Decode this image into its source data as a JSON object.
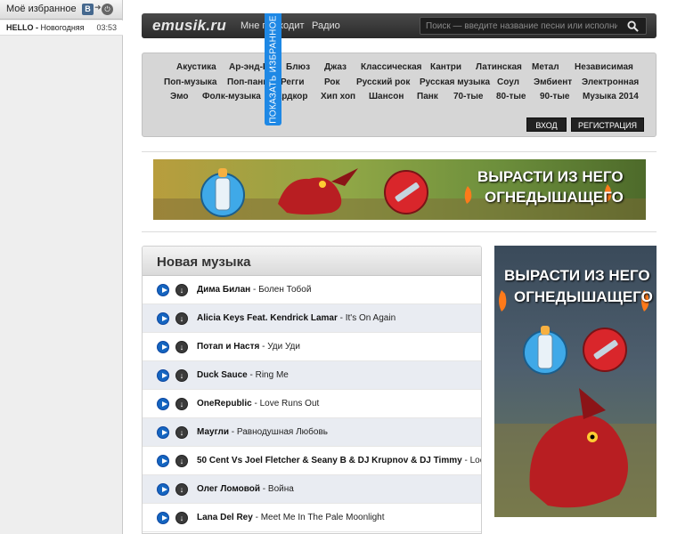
{
  "sidebar": {
    "title": "Моё избранное",
    "vk_label": "В",
    "track": {
      "name": "HELLO - ",
      "title": "Новогодняя",
      "duration": "03:53"
    }
  },
  "favorites_tab": "ПОКАЗАТЬ ИЗБРАННОЕ",
  "header": {
    "logo": "emusik.ru",
    "nav": [
      "Мне подходит",
      "Радио"
    ],
    "search_placeholder": "Поиск — введите название песни или исполнителя"
  },
  "genres": [
    [
      "Акустика",
      "Ар-энд-Би",
      "Блюз",
      "Джаз",
      "Классическая",
      "Кантри",
      "Латинская",
      "Метал",
      "Независимая"
    ],
    [
      "Поп-музыка",
      "Поп-панк",
      "Регги",
      "Рок",
      "Русский рок",
      "Русская музыка",
      "Соул",
      "Эмбиент",
      "Электронная"
    ],
    [
      "Эмо",
      "Фолк-музыка",
      "Хардкор",
      "Хип хоп",
      "Шансон",
      "Панк",
      "70-тые",
      "80-тые",
      "90-тые",
      "Музыка 2014"
    ]
  ],
  "auth": {
    "login": "ВХОД",
    "register": "РЕГИСТРАЦИЯ"
  },
  "banner": {
    "slogan_line1": "ВЫРАСТИ ИЗ НЕГО",
    "slogan_line2": "ОГНЕДЫШАЩЕГО"
  },
  "new_music": {
    "title": "Новая музыка",
    "tracks": [
      {
        "artist": "Дима Билан",
        "song": "Болен Тобой"
      },
      {
        "artist": "Alicia Keys Feat. Kendrick Lamar",
        "song": "It's On Again"
      },
      {
        "artist": "Потап и Настя",
        "song": "Уди Уди"
      },
      {
        "artist": "Duck Sauce",
        "song": "Ring Me"
      },
      {
        "artist": "OneRepublic",
        "song": "Love Runs Out"
      },
      {
        "artist": "Маугли",
        "song": "Равнодушная Любовь"
      },
      {
        "artist": "50 Cent Vs Joel Fletcher & Seany B & DJ Krupnov & DJ Timmy",
        "song": "Loco Canc"
      },
      {
        "artist": "Олег Ломовой",
        "song": "Война"
      },
      {
        "artist": "Lana Del Rey",
        "song": "Meet Me In The Pale Moonlight"
      }
    ]
  },
  "ad": {
    "slogan_line1": "ВЫРАСТИ ИЗ НЕГО",
    "slogan_line2": "ОГНЕДЫШАЩЕГО"
  },
  "colors": {
    "accent_blue": "#1e88e5",
    "header_dark": "#2a2a2a",
    "play_blue": "#1565c0",
    "row_alt": "#e9ecf2"
  }
}
